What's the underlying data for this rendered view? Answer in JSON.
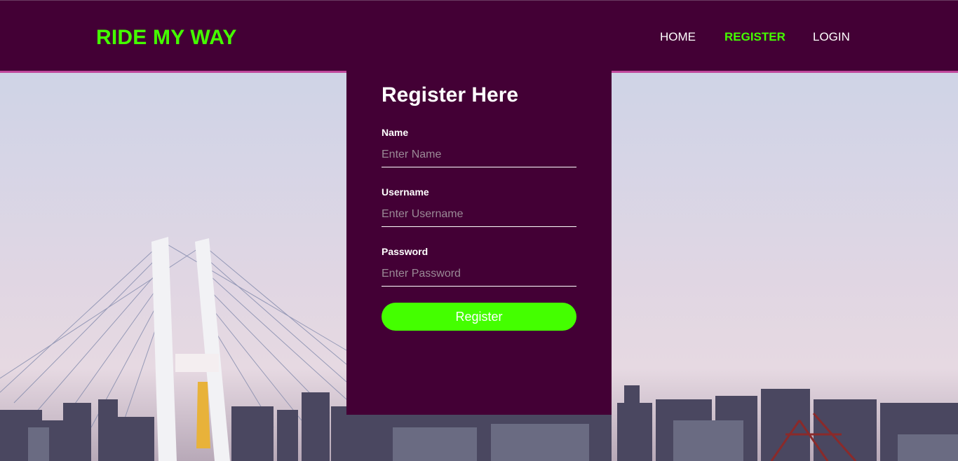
{
  "brand": {
    "title": "RIDE MY WAY"
  },
  "nav": {
    "home": "HOME",
    "register": "REGISTER",
    "login": "LOGIN"
  },
  "form": {
    "heading": "Register Here",
    "fields": [
      {
        "label": "Name",
        "placeholder": "Enter Name"
      },
      {
        "label": "Username",
        "placeholder": "Enter Username"
      },
      {
        "label": "Password",
        "placeholder": "Enter Password"
      }
    ],
    "submit_label": "Register"
  },
  "colors": {
    "header_bg": "#430035",
    "accent_green": "#44ff00",
    "header_border": "#c0479c"
  }
}
